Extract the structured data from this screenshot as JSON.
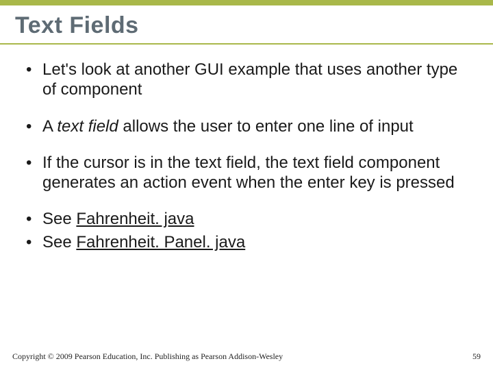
{
  "title": "Text Fields",
  "bullets": {
    "b1": "Let's look at another GUI example that uses another type of component",
    "b2_pre": "A ",
    "b2_italic": "text field",
    "b2_post": " allows the user to enter one line of input",
    "b3": "If the cursor is in the text field, the text field component generates an action event when the enter key is pressed",
    "b4_pre": "See ",
    "b4_link": "Fahrenheit. java",
    "b5_pre": "See ",
    "b5_link": "Fahrenheit. Panel. java"
  },
  "footer": {
    "copyright": "Copyright © 2009 Pearson Education, Inc. Publishing as Pearson Addison-Wesley",
    "page": "59"
  }
}
